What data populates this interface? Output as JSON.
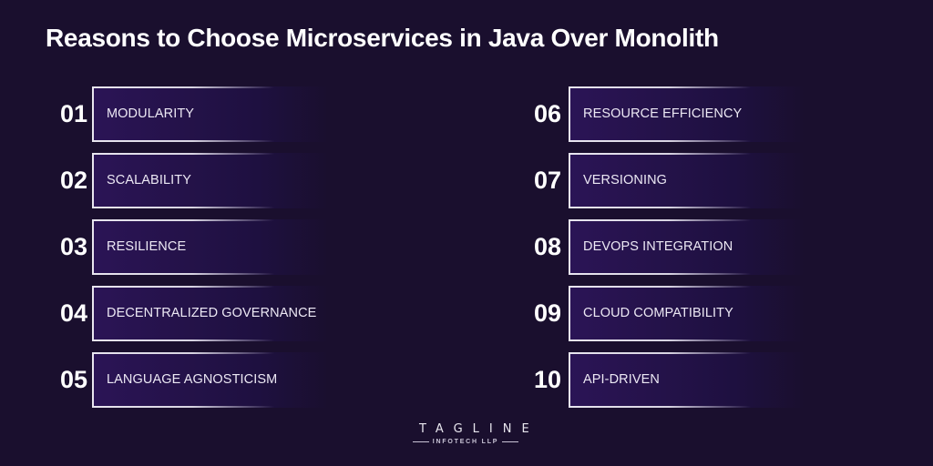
{
  "title": "Reasons to Choose Microservices in Java Over Monolith",
  "colors": {
    "background": "#1a0f2e",
    "box_fill": "#2b1456",
    "box_border": "#e9e6f0",
    "text": "#ffffff"
  },
  "left_items": [
    {
      "number": "01",
      "label": "MODULARITY"
    },
    {
      "number": "02",
      "label": "SCALABILITY"
    },
    {
      "number": "03",
      "label": "RESILIENCE"
    },
    {
      "number": "04",
      "label": "DECENTRALIZED GOVERNANCE"
    },
    {
      "number": "05",
      "label": "LANGUAGE AGNOSTICISM"
    }
  ],
  "right_items": [
    {
      "number": "06",
      "label": "RESOURCE EFFICIENCY"
    },
    {
      "number": "07",
      "label": "VERSIONING"
    },
    {
      "number": "08",
      "label": "DEVOPS INTEGRATION"
    },
    {
      "number": "09",
      "label": "CLOUD COMPATIBILITY"
    },
    {
      "number": "10",
      "label": "API-DRIVEN"
    }
  ],
  "logo": {
    "name": "TAGLINE",
    "subtitle": "INFOTECH LLP"
  }
}
